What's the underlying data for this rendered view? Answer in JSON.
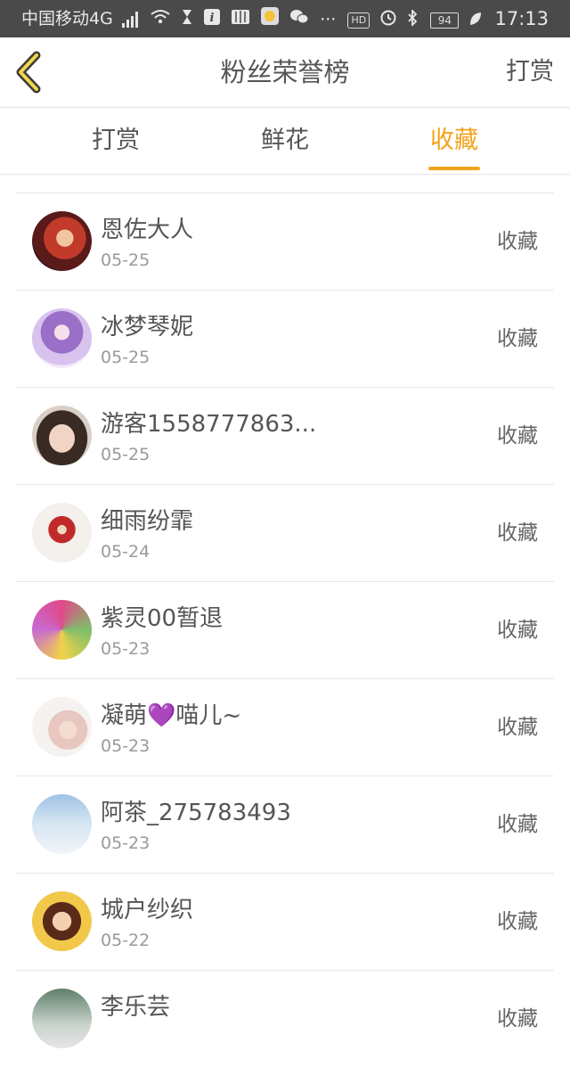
{
  "status_bar": {
    "carrier": "中国移动4G",
    "net_small": "4G",
    "hd_label": "HD",
    "battery": "94",
    "time": "17:13"
  },
  "nav": {
    "title": "粉丝荣誉榜",
    "right_action": "打赏"
  },
  "tabs": [
    {
      "label": "打赏",
      "active": false
    },
    {
      "label": "鲜花",
      "active": false
    },
    {
      "label": "收藏",
      "active": true
    }
  ],
  "colors": {
    "accent": "#f3a31b",
    "status_bar_bg": "#4a4a4a"
  },
  "fans": [
    {
      "name": "恩佐大人",
      "date": "05-25",
      "action": "收藏"
    },
    {
      "name": "冰梦琴妮",
      "date": "05-25",
      "action": "收藏"
    },
    {
      "name": "游客1558777863...",
      "date": "05-25",
      "action": "收藏"
    },
    {
      "name": "细雨纷霏",
      "date": "05-24",
      "action": "收藏"
    },
    {
      "name": "紫灵00暂退",
      "date": "05-23",
      "action": "收藏"
    },
    {
      "name": "凝萌💜喵儿~",
      "date": "05-23",
      "action": "收藏"
    },
    {
      "name": "阿茶_275783493",
      "date": "05-23",
      "action": "收藏"
    },
    {
      "name": "城户纱织",
      "date": "05-22",
      "action": "收藏"
    },
    {
      "name": "李乐芸",
      "date": "",
      "action": "收藏"
    }
  ]
}
